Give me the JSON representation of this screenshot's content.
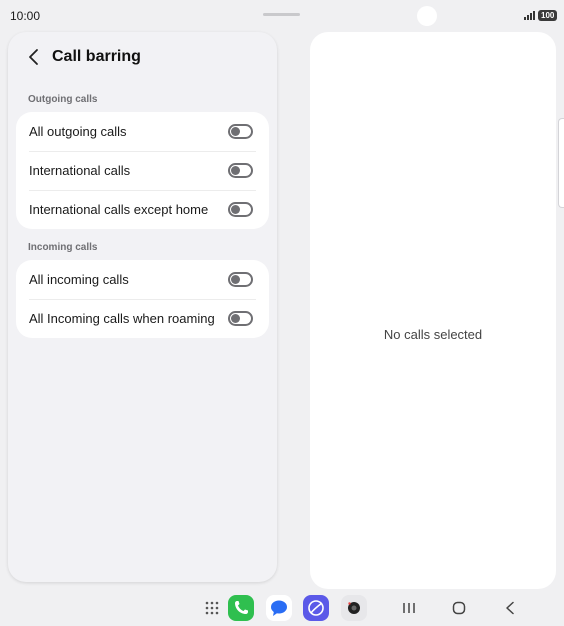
{
  "status_bar": {
    "time": "10:00",
    "battery": "100"
  },
  "header": {
    "title": "Call barring"
  },
  "sections": [
    {
      "label": "Outgoing calls",
      "items": [
        {
          "label": "All outgoing calls",
          "enabled": false
        },
        {
          "label": "International calls",
          "enabled": false
        },
        {
          "label": "International calls except home",
          "enabled": false
        }
      ]
    },
    {
      "label": "Incoming calls",
      "items": [
        {
          "label": "All incoming calls",
          "enabled": false
        },
        {
          "label": "All Incoming calls when roaming",
          "enabled": false
        }
      ]
    }
  ],
  "detail_panel": {
    "empty_message": "No calls selected"
  },
  "colors": {
    "background": "#f0f0f2",
    "panel": "#ffffff",
    "toggle_off": "#6f6f73",
    "phone_app": "#2fbf4f",
    "browser_app": "#5b59e8"
  }
}
